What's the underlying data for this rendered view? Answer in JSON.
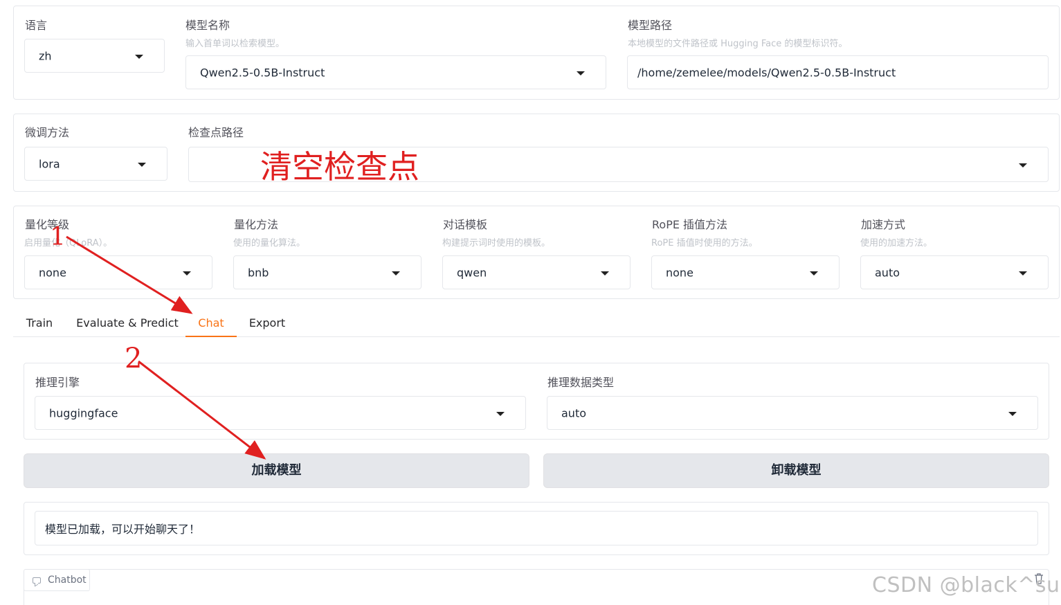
{
  "top_row": {
    "language": {
      "label": "语言",
      "value": "zh"
    },
    "model_name": {
      "label": "模型名称",
      "info": "输入首单词以检索模型。",
      "value": "Qwen2.5-0.5B-Instruct"
    },
    "model_path": {
      "label": "模型路径",
      "info": "本地模型的文件路径或 Hugging Face 的模型标识符。",
      "value": "/home/zemelee/models/Qwen2.5-0.5B-Instruct"
    }
  },
  "finetune_row": {
    "method": {
      "label": "微调方法",
      "value": "lora"
    },
    "checkpoint": {
      "label": "检查点路径",
      "value": ""
    }
  },
  "advanced_row": {
    "quant_bit": {
      "label": "量化等级",
      "info": "启用量化（QLoRA）。",
      "value": "none"
    },
    "quant_method": {
      "label": "量化方法",
      "info": "使用的量化算法。",
      "value": "bnb"
    },
    "template": {
      "label": "对话模板",
      "info": "构建提示词时使用的模板。",
      "value": "qwen"
    },
    "rope": {
      "label": "RoPE 插值方法",
      "info": "RoPE 插值时使用的方法。",
      "value": "none"
    },
    "booster": {
      "label": "加速方式",
      "info": "使用的加速方法。",
      "value": "auto"
    }
  },
  "tabs": [
    {
      "label": "Train"
    },
    {
      "label": "Evaluate & Predict"
    },
    {
      "label": "Chat"
    },
    {
      "label": "Export"
    }
  ],
  "active_tab": "Chat",
  "chat_panel": {
    "infer_backend": {
      "label": "推理引擎",
      "value": "huggingface"
    },
    "infer_dtype": {
      "label": "推理数据类型",
      "value": "auto"
    },
    "load_button": "加载模型",
    "unload_button": "卸载模型",
    "status": "模型已加载，可以开始聊天了！",
    "chatbot_label": "Chatbot"
  },
  "annotations": {
    "clear_checkpoint": "清空检查点",
    "step1": "1",
    "step2": "2"
  },
  "watermark": "CSDN @black^sugar",
  "colors": {
    "accent": "#f97316",
    "annotation_red": "#e02020",
    "button_bg": "#e5e7eb",
    "border": "#e5e7eb"
  }
}
